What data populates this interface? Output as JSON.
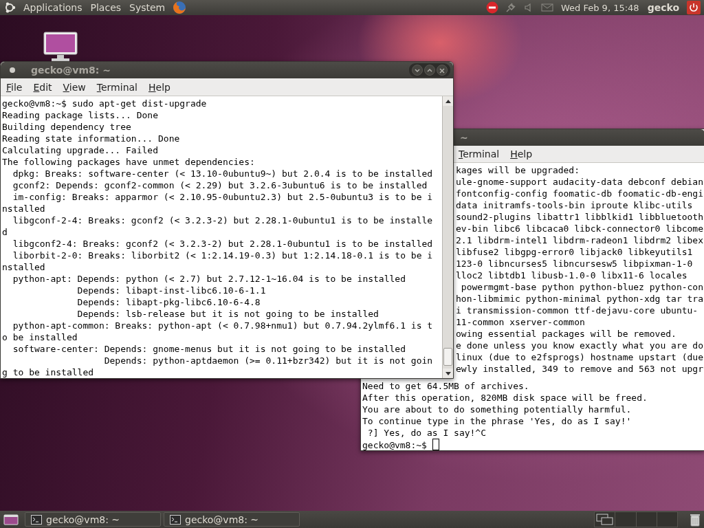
{
  "top_panel": {
    "menus": [
      "Applications",
      "Places",
      "System"
    ],
    "clock": "Wed Feb  9, 15:48",
    "user": "gecko"
  },
  "back_terminal": {
    "title": "~",
    "menus": [
      "Terminal",
      "Help"
    ],
    "covered_lines": [
      "kages will be upgraded:",
      "ule-gnome-support audacity-data debconf debian",
      "fontconfig-config foomatic-db foomatic-db-engi",
      "data initramfs-tools-bin iproute klibc-utils",
      "sound2-plugins libattr1 libblkid1 libbluetooth",
      "ev-bin libc6 libcaca0 libck-connector0 libcome",
      "2.1 libdrm-intel1 libdrm-radeon1 libdrm2 libex",
      "libfuse2 libgpg-error0 libjack0 libkeyutils1",
      "123-0 libncurses5 libncursesw5 libpixman-1-0",
      "lloc2 libtdb1 libusb-1.0-0 libx11-6 locales",
      " powermgmt-base python python-bluez python-con",
      "hon-libmimic python-minimal python-xdg tar tra",
      "i transmission-common ttf-dejavu-core ubuntu-",
      "11-common xserver-common",
      "owing essential packages will be removed.",
      "e done unless you know exactly what you are do",
      "linux (due to e2fsprogs) hostname upstart (due",
      "ewly installed, 349 to remove and 563 not upgr"
    ],
    "lines": [
      "Need to get 64.5MB of archives.",
      "After this operation, 820MB disk space will be freed.",
      "You are about to do something potentially harmful.",
      "To continue type in the phrase 'Yes, do as I say!'",
      " ?] Yes, do as I say!^C"
    ],
    "prompt": "gecko@vm8:~$ "
  },
  "front_terminal": {
    "title": "gecko@vm8: ~",
    "menus": [
      "File",
      "Edit",
      "View",
      "Terminal",
      "Help"
    ],
    "lines": [
      "gecko@vm8:~$ sudo apt-get dist-upgrade",
      "Reading package lists... Done",
      "Building dependency tree",
      "Reading state information... Done",
      "Calculating upgrade... Failed",
      "The following packages have unmet dependencies:",
      "  dpkg: Breaks: software-center (< 13.10-0ubuntu9~) but 2.0.4 is to be installed",
      "  gconf2: Depends: gconf2-common (< 2.29) but 3.2.6-3ubuntu6 is to be installed",
      "  im-config: Breaks: apparmor (< 2.10.95-0ubuntu2.3) but 2.5-0ubuntu3 is to be i",
      "nstalled",
      "  libgconf-2-4: Breaks: gconf2 (< 3.2.3-2) but 2.28.1-0ubuntu1 is to be installe",
      "d",
      "  libgconf2-4: Breaks: gconf2 (< 3.2.3-2) but 2.28.1-0ubuntu1 is to be installed",
      "  liborbit-2-0: Breaks: liborbit2 (< 1:2.14.19-0.3) but 1:2.14.18-0.1 is to be i",
      "nstalled",
      "  python-apt: Depends: python (< 2.7) but 2.7.12-1~16.04 is to be installed",
      "              Depends: libapt-inst-libc6.10-6-1.1",
      "              Depends: libapt-pkg-libc6.10-6-4.8",
      "              Depends: lsb-release but it is not going to be installed",
      "  python-apt-common: Breaks: python-apt (< 0.7.98+nmu1) but 0.7.94.2ylmf6.1 is t",
      "o be installed",
      "  software-center: Depends: gnome-menus but it is not going to be installed",
      "                   Depends: python-aptdaemon (>= 0.11+bzr342) but it is not goin",
      "g to be installed"
    ]
  },
  "taskbar": [
    {
      "label": "gecko@vm8: ~"
    },
    {
      "label": "gecko@vm8: ~"
    }
  ]
}
